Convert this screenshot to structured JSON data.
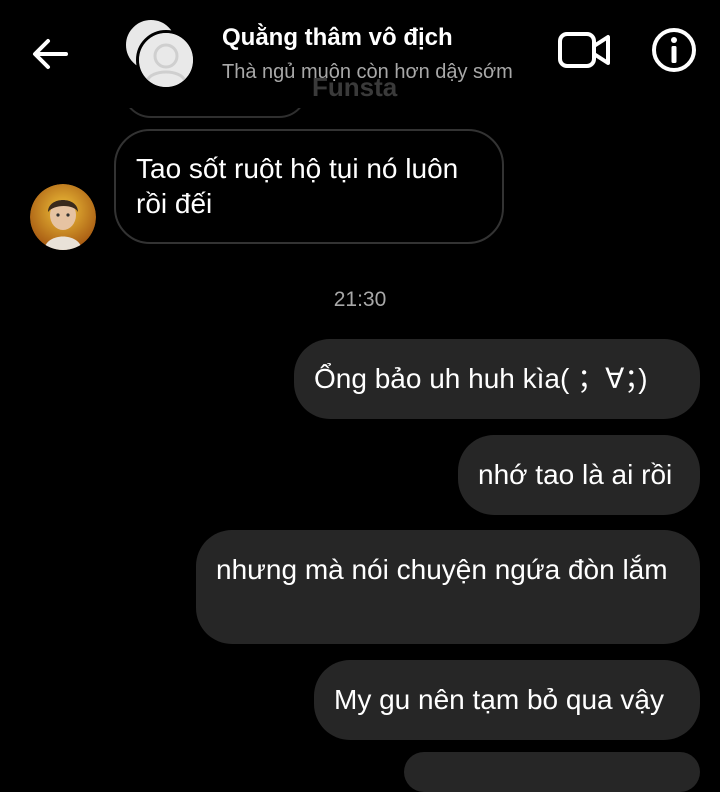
{
  "header": {
    "title": "Quằng thâm vô địch",
    "subtitle": "Thà ngủ muộn còn hơn dậy sớm",
    "faded_label": "Funsta",
    "back_icon": "arrow-left-icon",
    "video_icon": "video-camera-icon",
    "info_icon": "info-icon"
  },
  "messages": [
    {
      "direction": "received",
      "text": "Tao sốt ruột hộ tụi nó luôn rồi đếi"
    },
    {
      "direction": "timestamp",
      "text": "21:30"
    },
    {
      "direction": "sent",
      "text": "Ổng bảo uh huh kìa( ；∀；)"
    },
    {
      "direction": "sent",
      "text": "nhớ tao là ai rồi"
    },
    {
      "direction": "sent",
      "text": "nhưng mà nói chuyện ngứa đòn lắm"
    },
    {
      "direction": "sent",
      "text": "My gu nên tạm bỏ qua vậy"
    }
  ],
  "colors": {
    "background": "#000000",
    "sent_bubble": "#262626",
    "received_border": "#333333",
    "muted_text": "#a8a8a8"
  }
}
